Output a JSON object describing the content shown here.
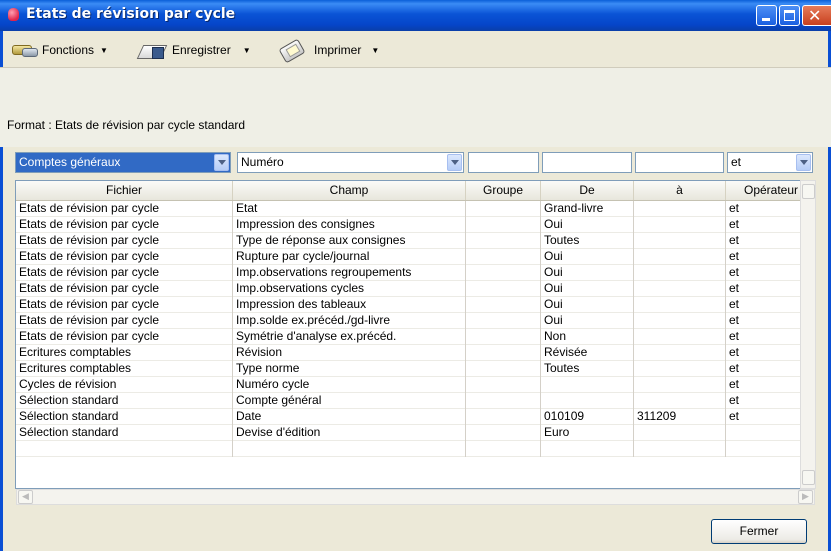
{
  "window": {
    "title": "Etats de révision par cycle"
  },
  "toolbar": {
    "functions_label": "Fonctions",
    "save_label": "Enregistrer",
    "print_label": "Imprimer"
  },
  "format": {
    "label": "Format : Etats de révision par cycle standard"
  },
  "filters": {
    "file_value": "Comptes généraux",
    "field_value": "Numéro",
    "group_value": "",
    "from_value": "",
    "to_value": "",
    "operator_value": "et"
  },
  "grid": {
    "headers": [
      "Fichier",
      "Champ",
      "Groupe",
      "De",
      "à",
      "Opérateur"
    ],
    "rows": [
      [
        "Etats de révision par cycle",
        "Etat",
        "",
        "Grand-livre",
        "",
        "et"
      ],
      [
        "Etats de révision par cycle",
        "Impression des consignes",
        "",
        "Oui",
        "",
        "et"
      ],
      [
        "Etats de révision par cycle",
        "Type de réponse aux consignes",
        "",
        "Toutes",
        "",
        "et"
      ],
      [
        "Etats de révision par cycle",
        "Rupture par cycle/journal",
        "",
        "Oui",
        "",
        "et"
      ],
      [
        "Etats de révision par cycle",
        "Imp.observations regroupements",
        "",
        "Oui",
        "",
        "et"
      ],
      [
        "Etats de révision par cycle",
        "Imp.observations cycles",
        "",
        "Oui",
        "",
        "et"
      ],
      [
        "Etats de révision par cycle",
        "Impression des tableaux",
        "",
        "Oui",
        "",
        "et"
      ],
      [
        "Etats de révision par cycle",
        "Imp.solde ex.précéd./gd-livre",
        "",
        "Oui",
        "",
        "et"
      ],
      [
        "Etats de révision par cycle",
        "Symétrie d'analyse ex.précéd.",
        "",
        "Non",
        "",
        "et"
      ],
      [
        "Ecritures comptables",
        "Révision",
        "",
        "Révisée",
        "",
        "et"
      ],
      [
        "Ecritures comptables",
        "Type norme",
        "",
        "Toutes",
        "",
        "et"
      ],
      [
        "Cycles de révision",
        "Numéro cycle",
        "",
        "",
        "",
        "et"
      ],
      [
        "Sélection standard",
        "Compte général",
        "",
        "",
        "",
        "et"
      ],
      [
        "Sélection standard",
        "Date",
        "",
        "010109",
        "311209",
        "et"
      ],
      [
        "Sélection standard",
        "Devise d'édition",
        "",
        "Euro",
        "",
        ""
      ],
      [
        "",
        "",
        "",
        "",
        "",
        ""
      ]
    ]
  },
  "footer": {
    "close_label": "Fermer"
  }
}
